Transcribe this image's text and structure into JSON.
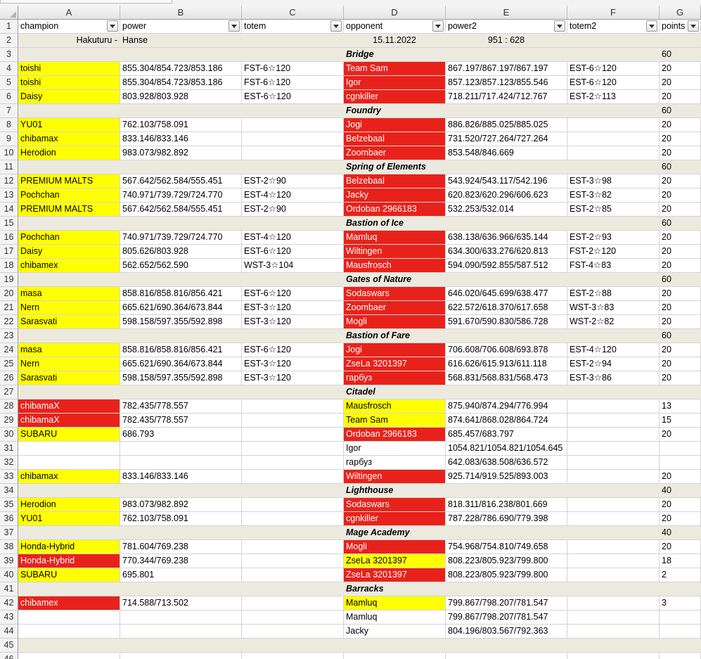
{
  "columns": [
    "A",
    "B",
    "C",
    "D",
    "E",
    "F",
    "G"
  ],
  "headers": [
    "champion",
    "power",
    "totem",
    "opponent",
    "power2",
    "totem2",
    "points"
  ],
  "match": {
    "team_a": "Hakuturu -",
    "team_b": "Hanse",
    "date": "15.11.2022",
    "score": "951 : 628"
  },
  "rows": [
    {
      "n": "1",
      "type": "header"
    },
    {
      "n": "2",
      "type": "match"
    },
    {
      "n": "3",
      "type": "arena",
      "name": "Bridge",
      "pts": "60"
    },
    {
      "n": "4",
      "a": "toishi",
      "af": "yellow",
      "b": "855.304/854.723/853.186",
      "c": "FST-6☆120",
      "d": "Team Sam",
      "df": "red",
      "e": "867.197/867.197/867.197",
      "f": "EST-6☆120",
      "g": "20"
    },
    {
      "n": "5",
      "a": "toishi",
      "af": "yellow",
      "b": "855.304/854.723/853.186",
      "c": "FST-6☆120",
      "d": "Igor",
      "df": "red",
      "e": "857.123/857.123/855.546",
      "f": "EST-6☆120",
      "g": "20"
    },
    {
      "n": "6",
      "a": "Daisy",
      "af": "yellow",
      "b": "803.928/803.928",
      "c": "EST-6☆120",
      "d": "cgnkiller",
      "df": "red",
      "e": "718.211/717.424/712.767",
      "f": "EST-2☆113",
      "g": "20"
    },
    {
      "n": "7",
      "type": "arena",
      "name": "Foundry",
      "pts": "60"
    },
    {
      "n": "8",
      "a": "YU01",
      "af": "yellow",
      "b": "762.103/758.091",
      "c": "",
      "d": "Jogi",
      "df": "red",
      "e": "886.826/885.025/885.025",
      "f": "",
      "g": "20"
    },
    {
      "n": "9",
      "a": "chibamax",
      "af": "yellow",
      "b": "833.146/833.146",
      "c": "",
      "d": "Belzebaal",
      "df": "red",
      "e": "731.520/727.264/727.264",
      "f": "",
      "g": "20"
    },
    {
      "n": "10",
      "a": "Herodion",
      "af": "yellow",
      "b": "983.073/982.892",
      "c": "",
      "d": "Zoombaer",
      "df": "red",
      "e": "853.548/846.669",
      "f": "",
      "g": "20"
    },
    {
      "n": "11",
      "type": "arena",
      "name": "Spring of Elements",
      "pts": "60"
    },
    {
      "n": "12",
      "a": "PREMIUM MALTS",
      "af": "yellow",
      "b": "567.642/562.584/555.451",
      "c": "EST-2☆90",
      "d": "Belzebaal",
      "df": "red",
      "e": "543.924/543.117/542.196",
      "f": "EST-3☆98",
      "g": "20"
    },
    {
      "n": "13",
      "a": "Pochchan",
      "af": "yellow",
      "b": "740.971/739.729/724.770",
      "c": "EST-4☆120",
      "d": "Jacky",
      "df": "red",
      "e": "620.823/620.296/606.623",
      "f": "EST-3☆82",
      "g": "20"
    },
    {
      "n": "14",
      "a": "PREMIUM MALTS",
      "af": "yellow",
      "b": "567.642/562.584/555.451",
      "c": "EST-2☆90",
      "d": "Ordoban 2966183",
      "df": "red",
      "e": "532.253/532.014",
      "f": "EST-2☆85",
      "g": "20"
    },
    {
      "n": "15",
      "type": "arena",
      "name": "Bastion of Ice",
      "pts": "60"
    },
    {
      "n": "16",
      "a": "Pochchan",
      "af": "yellow",
      "b": "740.971/739.729/724.770",
      "c": "EST-4☆120",
      "d": "Mamluq",
      "df": "red",
      "e": "638.138/636.966/635.144",
      "f": "EST-2☆93",
      "g": "20"
    },
    {
      "n": "17",
      "a": "Daisy",
      "af": "yellow",
      "b": "805.626/803.928",
      "c": "EST-6☆120",
      "d": "Wiltingen",
      "df": "red",
      "e": "634.300/633.276/620.813",
      "f": "FST-2☆120",
      "g": "20"
    },
    {
      "n": "18",
      "a": "chibamex",
      "af": "yellow",
      "b": "562.652/562.590",
      "c": "WST-3☆104",
      "d": "Mausfrosch",
      "df": "red",
      "e": "594.090/592.855/587.512",
      "f": "FST-4☆83",
      "g": "20"
    },
    {
      "n": "19",
      "type": "arena",
      "name": "Gates of Nature",
      "pts": "60"
    },
    {
      "n": "20",
      "a": "masa",
      "af": "yellow",
      "b": "858.816/858.816/856.421",
      "c": "EST-6☆120",
      "d": "Sodaswars",
      "df": "red",
      "e": "646.020/645.699/638.477",
      "f": "EST-2☆88",
      "g": "20"
    },
    {
      "n": "21",
      "a": "Nern",
      "af": "yellow",
      "b": "665.621/690.364/673.844",
      "c": "EST-3☆120",
      "d": "Zoombaer",
      "df": "red",
      "e": "622.572/618.370/617.658",
      "f": "WST-3☆83",
      "g": "20"
    },
    {
      "n": "22",
      "a": "Sarasvati",
      "af": "yellow",
      "b": "598.158/597.355/592.898",
      "c": "EST-3☆120",
      "d": "Mogli",
      "df": "red",
      "e": "591.670/590.830/586.728",
      "f": "WST-2☆82",
      "g": "20"
    },
    {
      "n": "23",
      "type": "arena",
      "name": "Bastion of Fare",
      "pts": "60"
    },
    {
      "n": "24",
      "a": "masa",
      "af": "yellow",
      "b": "858.816/858.816/856.421",
      "c": "EST-6☆120",
      "d": "Jogi",
      "df": "red",
      "e": "706.608/706.608/693.878",
      "f": "EST-4☆120",
      "g": "20"
    },
    {
      "n": "25",
      "a": "Nern",
      "af": "yellow",
      "b": "665.621/690.364/673.844",
      "c": "EST-3☆120",
      "d": "ZseLa 3201397",
      "df": "red",
      "e": "616.626/615.913/611.118",
      "f": "EST-2☆94",
      "g": "20"
    },
    {
      "n": "26",
      "a": "Sarasvati",
      "af": "yellow",
      "b": "598.158/597.355/592.898",
      "c": "EST-3☆120",
      "d": "гарбуз",
      "df": "red",
      "e": "568.831/568.831/568.473",
      "f": "EST-3☆86",
      "g": "20"
    },
    {
      "n": "27",
      "type": "arena",
      "name": "Citadel",
      "pts": ""
    },
    {
      "n": "28",
      "a": "chibamaX",
      "af": "red",
      "b": "782.435/778.557",
      "c": "",
      "d": "Mausfrosch",
      "df": "yellow",
      "e": "875.940/874.294/776.994",
      "f": "",
      "g": "13"
    },
    {
      "n": "29",
      "a": "chibamaX",
      "af": "red",
      "b": "782.435/778.557",
      "c": "",
      "d": "Team Sam",
      "df": "yellow",
      "e": "874.641/868.028/864.724",
      "f": "",
      "g": "15"
    },
    {
      "n": "30",
      "a": "SUBARU",
      "af": "yellow",
      "b": "686.793",
      "c": "",
      "d": "Ordoban 2966183",
      "df": "red",
      "e": "685.457/683.797",
      "f": "",
      "g": "20"
    },
    {
      "n": "31",
      "a": "",
      "af": "",
      "b": "",
      "c": "",
      "d": "Igor",
      "df": "",
      "e": "1054.821/1054.821/1054.645",
      "f": "",
      "g": ""
    },
    {
      "n": "32",
      "a": "",
      "af": "",
      "b": "",
      "c": "",
      "d": "гарбуз",
      "df": "",
      "e": "642.083/638.508/636.572",
      "f": "",
      "g": ""
    },
    {
      "n": "33",
      "a": "chibamax",
      "af": "yellow",
      "b": "833.146/833.146",
      "c": "",
      "d": "Wiltingen",
      "df": "red",
      "e": "925.714/919.525/893.003",
      "f": "",
      "g": "20"
    },
    {
      "n": "34",
      "type": "arena",
      "name": "Lighthouse",
      "pts": "40"
    },
    {
      "n": "35",
      "a": "Herodion",
      "af": "yellow",
      "b": "983.073/982.892",
      "c": "",
      "d": "Sodaswars",
      "df": "red",
      "e": "818.311/816.238/801.669",
      "f": "",
      "g": "20"
    },
    {
      "n": "36",
      "a": "YU01",
      "af": "yellow",
      "b": "762.103/758.091",
      "c": "",
      "d": "cgnkiller",
      "df": "red",
      "e": "787.228/786.690/779.398",
      "f": "",
      "g": "20"
    },
    {
      "n": "37",
      "type": "arena",
      "name": "Mage Academy",
      "pts": "40"
    },
    {
      "n": "38",
      "a": "Honda-Hybrid",
      "af": "yellow",
      "b": "781.604/769.238",
      "c": "",
      "d": "Mogli",
      "df": "red",
      "e": "754.968/754.810/749.658",
      "f": "",
      "g": "20"
    },
    {
      "n": "39",
      "a": "Honda-Hybrid",
      "af": "red",
      "b": "770.344/769.238",
      "c": "",
      "d": "ZseLa 3201397",
      "df": "yellow",
      "e": "808.223/805.923/799.800",
      "f": "",
      "g": "18"
    },
    {
      "n": "40",
      "a": "SUBARU",
      "af": "yellow",
      "b": "695.801",
      "c": "",
      "d": "ZseLa 3201397",
      "df": "red",
      "e": "808.223/805.923/799.800",
      "f": "",
      "g": "2"
    },
    {
      "n": "41",
      "type": "arena",
      "name": "Barracks",
      "pts": ""
    },
    {
      "n": "42",
      "a": "chibamex",
      "af": "red",
      "b": "714.588/713.502",
      "c": "",
      "d": "Mamluq",
      "df": "yellow",
      "e": "799.867/798.207/781.547",
      "f": "",
      "g": "3"
    },
    {
      "n": "43",
      "a": "",
      "af": "",
      "b": "",
      "c": "",
      "d": "Mamluq",
      "df": "",
      "e": "799.867/798.207/781.547",
      "f": "",
      "g": ""
    },
    {
      "n": "44",
      "a": "",
      "af": "",
      "b": "",
      "c": "",
      "d": "Jacky",
      "df": "",
      "e": "804.196/803.567/792.363",
      "f": "",
      "g": ""
    },
    {
      "n": "45",
      "type": "sep"
    },
    {
      "n": "46",
      "type": "blank"
    }
  ]
}
